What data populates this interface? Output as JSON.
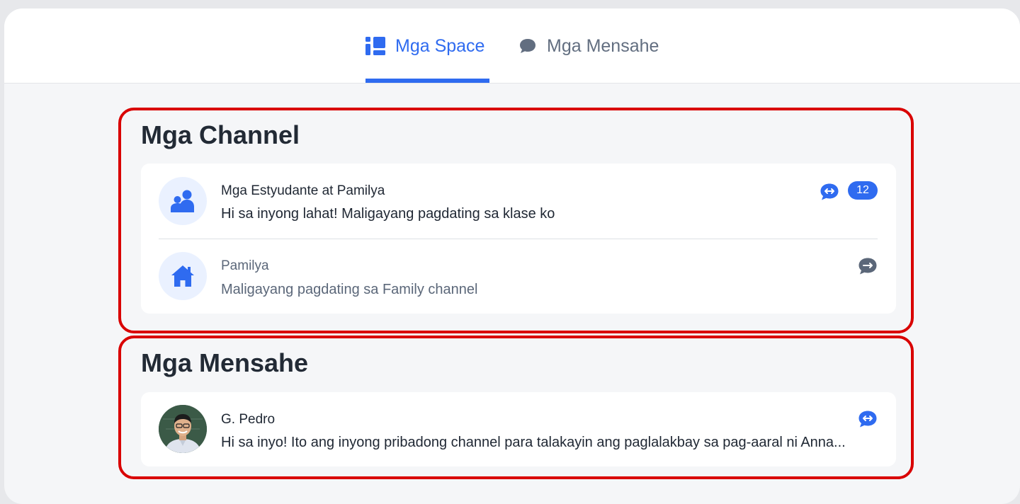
{
  "tabs": [
    {
      "label": "Mga Space",
      "icon": "spaces-icon",
      "active": true
    },
    {
      "label": "Mga Mensahe",
      "icon": "chat-bubble-icon",
      "active": false
    }
  ],
  "channels": {
    "title": "Mga Channel",
    "items": [
      {
        "name": "Mga Estyudante at Pamilya",
        "message": "Hi sa inyong lahat! Maligayang pagdating sa klase ko",
        "icon": "group-icon",
        "unread_count": "12",
        "status_color": "#2f6bf0"
      },
      {
        "name": "Pamilya",
        "message": "Maligayang pagdating sa Family channel",
        "icon": "house-icon",
        "status_color": "#5b6779"
      }
    ]
  },
  "messages": {
    "title": "Mga Mensahe",
    "items": [
      {
        "name": "G. Pedro",
        "message": "Hi sa inyo! Ito ang inyong pribadong channel para talakayin ang paglalakbay sa pag-aaral ni Anna...",
        "icon": "person-avatar",
        "status_color": "#2f6bf0"
      }
    ]
  },
  "colors": {
    "accent": "#2f6bf0",
    "highlight_border": "#d90000"
  }
}
